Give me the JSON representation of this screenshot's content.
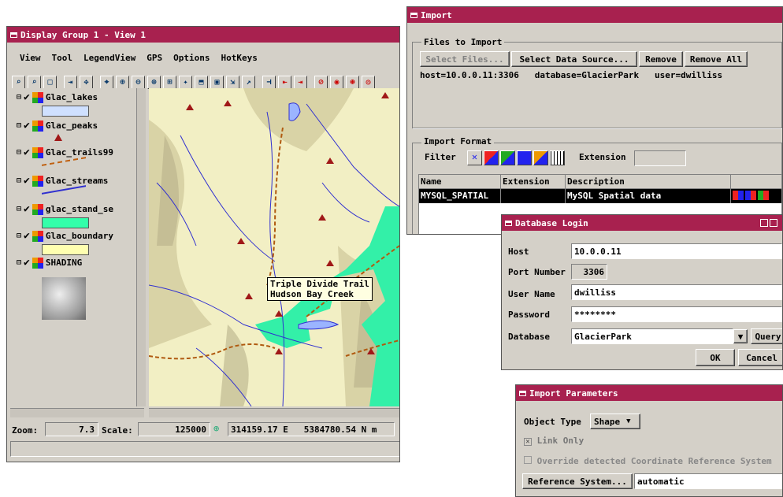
{
  "display_window": {
    "title": "Display Group 1 - View 1",
    "menu": [
      "View",
      "Tool",
      "LegendView",
      "GPS",
      "Options",
      "HotKeys"
    ],
    "layers": [
      {
        "name": "Glac_lakes",
        "swatch": "#cfe0ff"
      },
      {
        "name": "Glac_peaks",
        "swatch": "#a01818"
      },
      {
        "name": "Glac_trails99",
        "swatch": "#c06010"
      },
      {
        "name": "Glac_streams",
        "swatch": "#3030d0"
      },
      {
        "name": "glac_stand_se",
        "swatch": "#33ffaa"
      },
      {
        "name": "Glac_boundary",
        "swatch": "#ffffb0"
      },
      {
        "name": "SHADING",
        "swatch": "#bbbbbb"
      }
    ],
    "tooltip": [
      "Triple Divide Trail",
      "Hudson Bay Creek"
    ],
    "status": {
      "zoom_label": "Zoom:",
      "zoom": "7.3",
      "scale_label": "Scale:",
      "scale": "125000",
      "coords": "314159.17 E   5384780.54 N m"
    }
  },
  "import_window": {
    "title": "Import",
    "files_group": "Files to Import",
    "buttons": {
      "select_files": "Select Files...",
      "select_source": "Select Data Source...",
      "remove": "Remove",
      "remove_all": "Remove All"
    },
    "file_entry": "host=10.0.0.11:3306   database=GlacierPark   user=dwilliss",
    "format_group": "Import Format",
    "filter_label": "Filter",
    "extension_label": "Extension",
    "columns": [
      "Name",
      "Extension",
      "Description"
    ],
    "row": {
      "name": "MYSQL_SPATIAL",
      "extension": "",
      "description": "MySQL Spatial data"
    }
  },
  "login_dialog": {
    "title": "Database Login",
    "host_label": "Host",
    "host": "10.0.0.11",
    "port_label": "Port Number",
    "port": "3306",
    "user_label": "User Name",
    "user": "dwilliss",
    "password_label": "Password",
    "password": "********",
    "database_label": "Database",
    "database": "GlacierPark",
    "query_button": "Query",
    "ok_button": "OK",
    "cancel_button": "Cancel"
  },
  "params_dialog": {
    "title": "Import Parameters",
    "object_type_label": "Object Type",
    "object_type": "Shape",
    "link_only": "Link Only",
    "override_crs": "Override detected Coordinate Reference System",
    "ref_button": "Reference System...",
    "ref_value": "automatic"
  },
  "colors": {
    "titlebar": "#a8214f",
    "panel": "#d4d0c8",
    "forest": "#33f0a8",
    "terrain": "#f2efc4"
  }
}
